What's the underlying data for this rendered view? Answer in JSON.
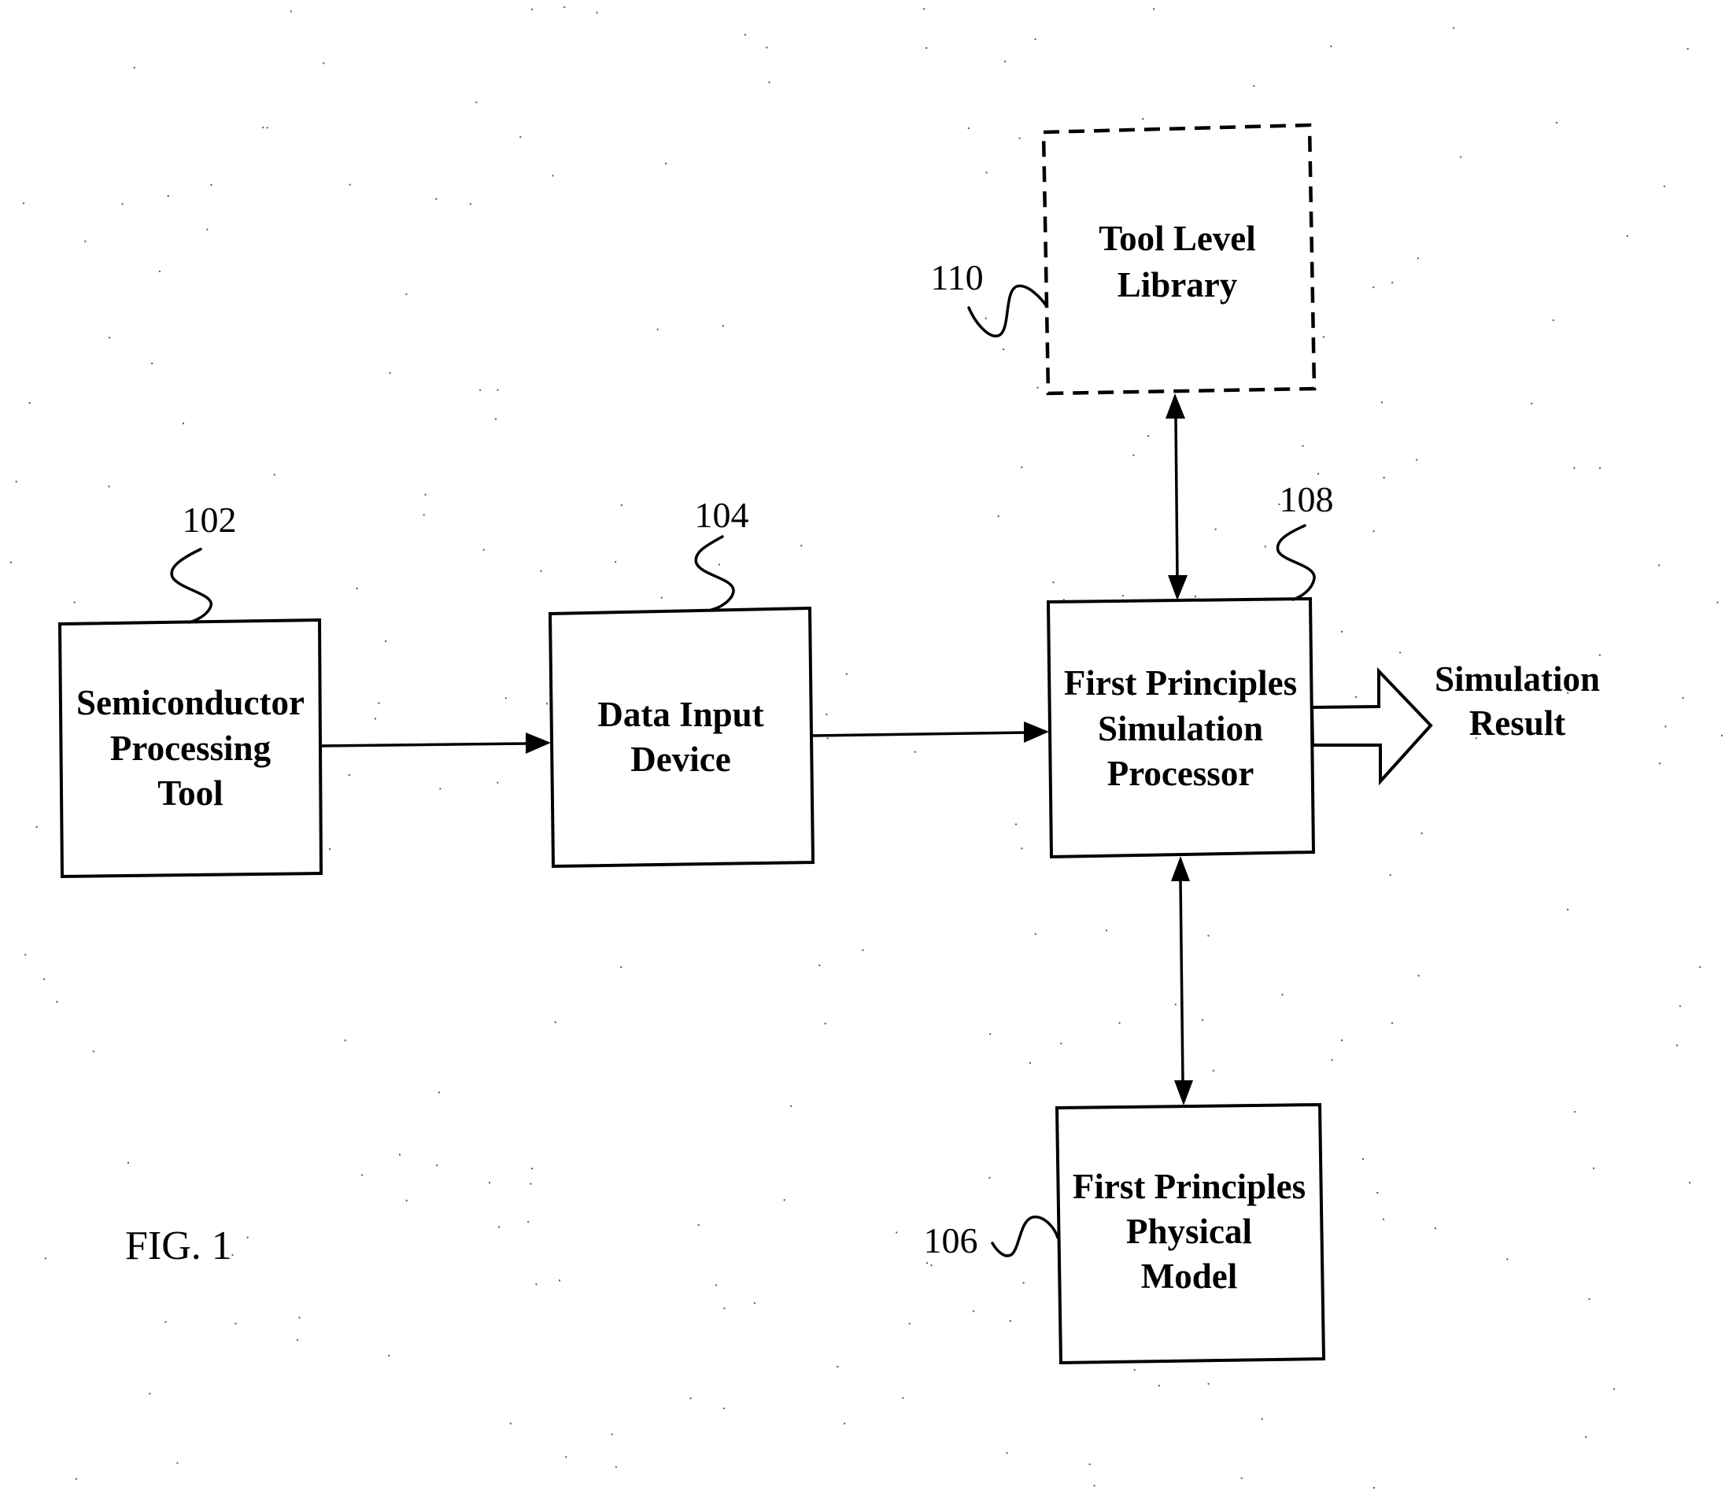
{
  "figure": {
    "caption": "FIG. 1"
  },
  "blocks": {
    "semiconductor_tool": {
      "ref": "102",
      "lines": [
        "Semiconductor",
        "Processing",
        "Tool"
      ]
    },
    "data_input_device": {
      "ref": "104",
      "lines": [
        "Data Input",
        "Device"
      ]
    },
    "simulation_processor": {
      "ref": "108",
      "lines": [
        "First Principles",
        "Simulation",
        "Processor"
      ]
    },
    "tool_level_library": {
      "ref": "110",
      "style": "dashed",
      "lines": [
        "Tool Level",
        "Library"
      ]
    },
    "physical_model": {
      "ref": "106",
      "lines": [
        "First Principles",
        "Physical",
        "Model"
      ]
    }
  },
  "output": {
    "lines": [
      "Simulation",
      "Result"
    ]
  },
  "connections": [
    {
      "from": "102",
      "to": "104",
      "type": "one-way"
    },
    {
      "from": "104",
      "to": "108",
      "type": "one-way"
    },
    {
      "from": "108",
      "to": "110",
      "type": "two-way"
    },
    {
      "from": "108",
      "to": "106",
      "type": "two-way"
    },
    {
      "from": "108",
      "to": "Simulation Result",
      "type": "block-arrow"
    }
  ]
}
